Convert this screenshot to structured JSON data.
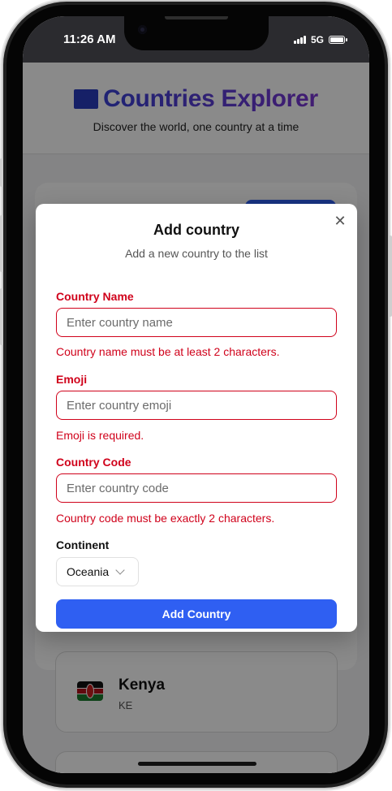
{
  "status_bar": {
    "time": "11:26 AM",
    "network": "5G"
  },
  "header": {
    "title": "Countries Explorer",
    "tagline": "Discover the world, one country at a time"
  },
  "countries": [
    {
      "name": "Kenya",
      "code": "KE"
    }
  ],
  "modal": {
    "title": "Add country",
    "description": "Add a new country to the list",
    "close_icon": "close-icon",
    "fields": {
      "name": {
        "label": "Country Name",
        "placeholder": "Enter country name",
        "value": "",
        "error": "Country name must be at least 2 characters."
      },
      "emoji": {
        "label": "Emoji",
        "placeholder": "Enter country emoji",
        "value": "",
        "error": "Emoji is required."
      },
      "code": {
        "label": "Country Code",
        "placeholder": "Enter country code",
        "value": "",
        "error": "Country code must be exactly 2 characters."
      },
      "continent": {
        "label": "Continent",
        "selected": "Oceania"
      }
    },
    "submit_label": "Add Country"
  },
  "colors": {
    "primary": "#2f5ff2",
    "error": "#d0021b",
    "brand_gradient_start": "#3a42d6",
    "brand_gradient_end": "#7a36d3",
    "overlay": "#000000"
  }
}
